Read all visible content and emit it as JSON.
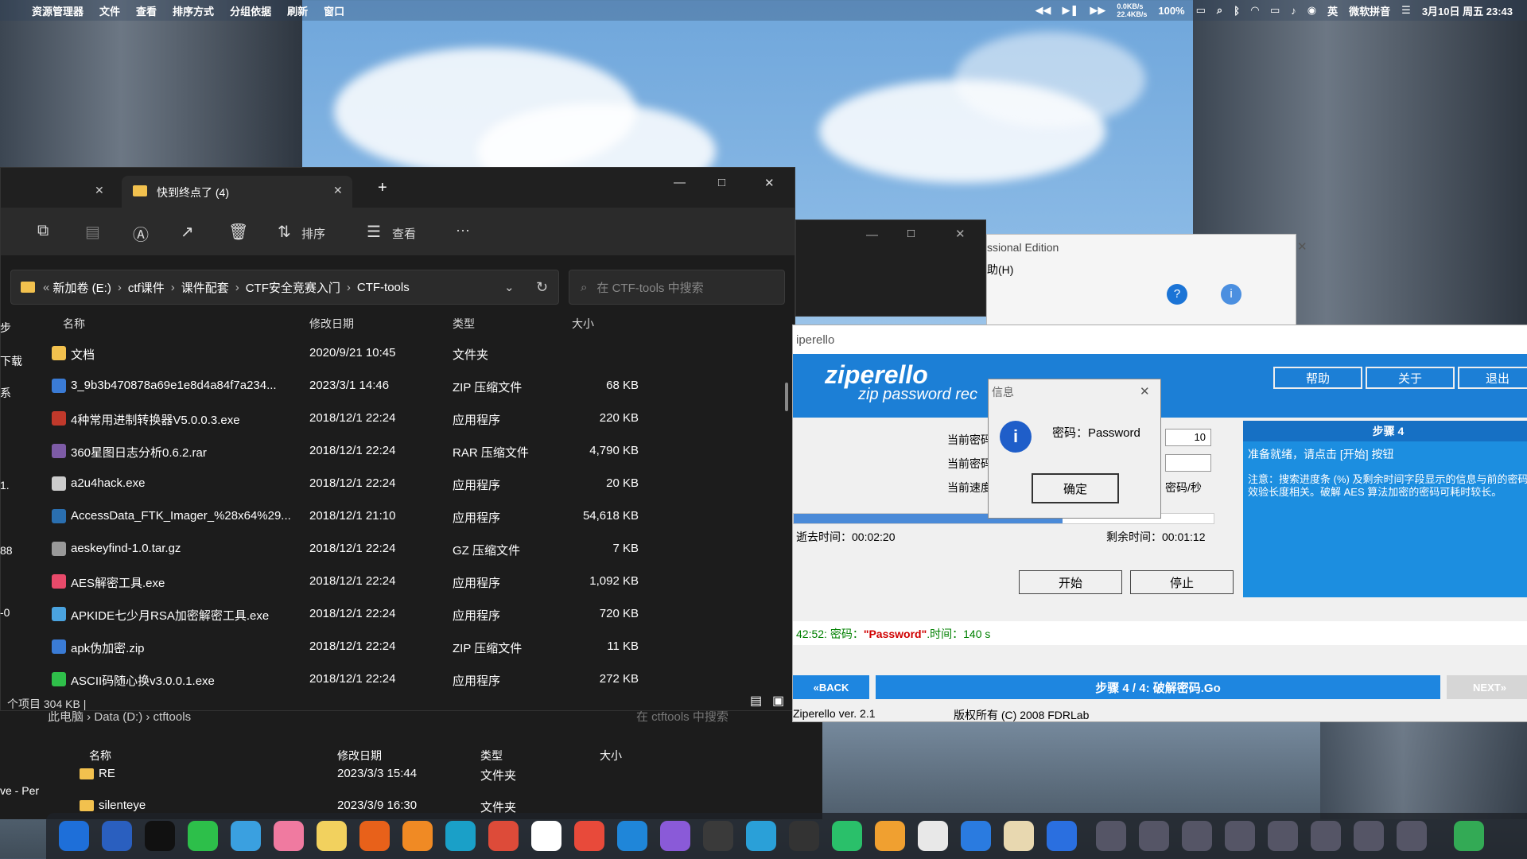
{
  "menubar": {
    "apple": "",
    "items": [
      "资源管理器",
      "文件",
      "查看",
      "排序方式",
      "分组依据",
      "刷新",
      "窗口"
    ],
    "net_up": "0.0KB/s",
    "net_down": "22.4KB/s",
    "battery": "100%",
    "ime": "微软拼音",
    "ime_short": "英",
    "datetime": "3月10日 周五 23:43"
  },
  "explorer": {
    "tab1_close": "✕",
    "tab2_label": "快到终点了 (4)",
    "tab2_close": "✕",
    "new_tab": "+",
    "sort_label": "排序",
    "view_label": "查看",
    "more": "···",
    "breadcrumb": [
      "新加卷 (E:)",
      "ctf课件",
      "课件配套",
      "CTF安全竞赛入门",
      "CTF-tools"
    ],
    "search_placeholder": "在 CTF-tools 中搜索",
    "columns": {
      "name": "名称",
      "date": "修改日期",
      "type": "类型",
      "size": "大小"
    },
    "files": [
      {
        "name": "文档",
        "date": "2020/9/21 10:45",
        "type": "文件夹",
        "size": ""
      },
      {
        "name": "3_9b3b470878a69e1e8d4a84f7a234...",
        "date": "2023/3/1 14:46",
        "type": "ZIP 压缩文件",
        "size": "68 KB"
      },
      {
        "name": "4种常用进制转换器V5.0.0.3.exe",
        "date": "2018/12/1 22:24",
        "type": "应用程序",
        "size": "220 KB"
      },
      {
        "name": "360星图日志分析0.6.2.rar",
        "date": "2018/12/1 22:24",
        "type": "RAR 压缩文件",
        "size": "4,790 KB"
      },
      {
        "name": "a2u4hack.exe",
        "date": "2018/12/1 22:24",
        "type": "应用程序",
        "size": "20 KB"
      },
      {
        "name": "AccessData_FTK_Imager_%28x64%29...",
        "date": "2018/12/1 21:10",
        "type": "应用程序",
        "size": "54,618 KB"
      },
      {
        "name": "aeskeyfind-1.0.tar.gz",
        "date": "2018/12/1 22:24",
        "type": "GZ 压缩文件",
        "size": "7 KB"
      },
      {
        "name": "AES解密工具.exe",
        "date": "2018/12/1 22:24",
        "type": "应用程序",
        "size": "1,092 KB"
      },
      {
        "name": "APKIDE七少月RSA加密解密工具.exe",
        "date": "2018/12/1 22:24",
        "type": "应用程序",
        "size": "720 KB"
      },
      {
        "name": "apk伪加密.zip",
        "date": "2018/12/1 22:24",
        "type": "ZIP 压缩文件",
        "size": "11 KB"
      },
      {
        "name": "ASCII码随心换v3.0.0.1.exe",
        "date": "2018/12/1 22:24",
        "type": "应用程序",
        "size": "272 KB"
      }
    ],
    "status": "个项目  304 KB  |",
    "side_fragments": [
      "步",
      "下载",
      "系",
      "1.",
      "88",
      "-0"
    ]
  },
  "explorer2": {
    "breadcrumb": [
      "此电脑",
      "Data (D:)",
      "ctftools"
    ],
    "search_placeholder": "在 ctftools 中搜索",
    "columns": {
      "name": "名称",
      "date": "修改日期",
      "type": "类型",
      "size": "大小"
    },
    "files": [
      {
        "name": "RE",
        "date": "2023/3/3 15:44",
        "type": "文件夹"
      },
      {
        "name": "silenteye",
        "date": "2023/3/9 16:30",
        "type": "文件夹"
      }
    ],
    "side_fragment": "ve - Per"
  },
  "ape": {
    "title": "ssional Edition",
    "menu": "助(H)"
  },
  "zip": {
    "title": "iperello",
    "logo": "ziperello",
    "logo_sub": "zip password rec",
    "help": "帮助",
    "about": "关于",
    "exit": "退出",
    "label1": "当前密码",
    "label2": "当前密码",
    "label3": "当前速度",
    "field1": "10",
    "speed_unit": "密码/秒",
    "elapsed": "逝去时间：00:02:20",
    "remaining": "剩余时间：00:01:12",
    "start": "开始",
    "stop": "停止",
    "step_title": "步骤 4",
    "step_ready": "准备就绪，请点击 [开始] 按钮",
    "step_note": "注意：搜索进度条 (%) 及剩余时间字段显示的信息与前的密码效验长度相关。破解 AES 算法加密的密码可耗时较长。",
    "log_prefix": "42:52: 密码：",
    "log_pw": "\"Password\"",
    "log_suffix": ".时间：140 s",
    "back": "BACK",
    "step_bar": "步骤 4 / 4: 破解密码.Go",
    "next": "NEXT",
    "version": "Ziperello ver. 2.1",
    "copyright": "版权所有 (C) 2008 FDRLab"
  },
  "dialog": {
    "title": "信息",
    "message": "密码：Password",
    "ok": "确定",
    "close": "✕"
  },
  "colors": {
    "zip_blue": "#1c7fd6",
    "explorer_bg": "#1c1c1c",
    "log_red": "#d00000"
  }
}
